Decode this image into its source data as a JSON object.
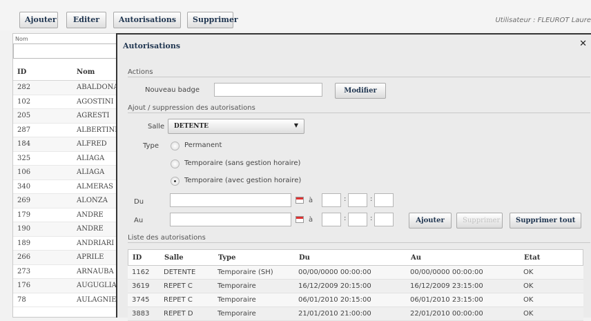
{
  "toolbar": {
    "ajouter": "Ajouter",
    "editer": "Editer",
    "autorisations": "Autorisations",
    "supprimer": "Supprimer",
    "user_info": "Utilisateur : FLEUROT Laure"
  },
  "left": {
    "search_label": "Nom",
    "search_value": "",
    "col_id": "ID",
    "col_nom": "Nom",
    "rows": [
      {
        "id": "282",
        "nom": "ABALDONATO"
      },
      {
        "id": "102",
        "nom": "AGOSTINI"
      },
      {
        "id": "205",
        "nom": "AGRESTI"
      },
      {
        "id": "287",
        "nom": "ALBERTINI"
      },
      {
        "id": "184",
        "nom": "ALFRED"
      },
      {
        "id": "325",
        "nom": "ALIAGA"
      },
      {
        "id": "106",
        "nom": "ALIAGA"
      },
      {
        "id": "340",
        "nom": "ALMERAS"
      },
      {
        "id": "269",
        "nom": "ALONZA"
      },
      {
        "id": "179",
        "nom": "ANDRE"
      },
      {
        "id": "190",
        "nom": "ANDRE"
      },
      {
        "id": "189",
        "nom": "ANDRIARI"
      },
      {
        "id": "266",
        "nom": "APRILE"
      },
      {
        "id": "273",
        "nom": "ARNAUBA"
      },
      {
        "id": "176",
        "nom": "AUGUGLIA"
      },
      {
        "id": "78",
        "nom": "AULAGNIE"
      }
    ]
  },
  "modal": {
    "title": "Autorisations",
    "close_icon": "close-icon",
    "actions_label": "Actions",
    "nouveau_badge_label": "Nouveau badge",
    "nouveau_badge_value": "",
    "modifier_label": "Modifier",
    "ajout_section_label": "Ajout / suppression des autorisations",
    "salle_label": "Salle",
    "salle_value": "DETENTE",
    "type_label": "Type",
    "radio_permanent": "Permanent",
    "radio_temp_sans": "Temporaire (sans gestion horaire)",
    "radio_temp_avec": "Temporaire (avec gestion horaire)",
    "selected_type": "avec",
    "du_label": "Du",
    "au_label": "Au",
    "a_label": "à",
    "colon": ":",
    "ajouter_label": "Ajouter",
    "supprimer_label": "Supprimer",
    "supprimer_tout_label": "Supprimer tout",
    "liste_label": "Liste des autorisations",
    "table": {
      "headers": {
        "id": "ID",
        "salle": "Salle",
        "type": "Type",
        "du": "Du",
        "au": "Au",
        "etat": "Etat"
      },
      "rows": [
        {
          "id": "1162",
          "salle": "DETENTE",
          "type": "Temporaire (SH)",
          "du": "00/00/0000 00:00:00",
          "au": "00/00/0000 00:00:00",
          "etat": "OK"
        },
        {
          "id": "3619",
          "salle": "REPET C",
          "type": "Temporaire",
          "du": "16/12/2009 20:15:00",
          "au": "16/12/2009 23:15:00",
          "etat": "OK"
        },
        {
          "id": "3745",
          "salle": "REPET C",
          "type": "Temporaire",
          "du": "06/01/2010 20:15:00",
          "au": "06/01/2010 23:15:00",
          "etat": "OK"
        },
        {
          "id": "3883",
          "salle": "REPET D",
          "type": "Temporaire",
          "du": "21/01/2010 21:00:00",
          "au": "22/01/2010 00:00:00",
          "etat": "OK"
        }
      ]
    }
  }
}
